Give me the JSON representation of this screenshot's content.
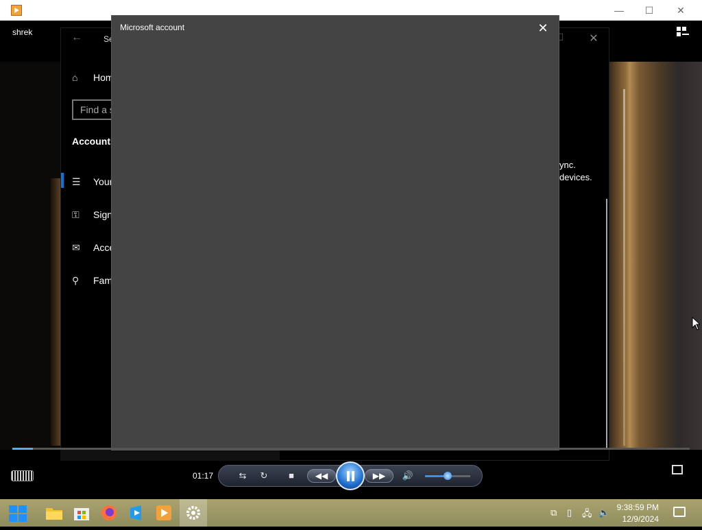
{
  "wmp": {
    "window_controls": {
      "minimize": "—",
      "maximize": "☐",
      "close": "✕"
    },
    "video_title": "shrek",
    "time": "01:17",
    "progress_fraction": 0.03,
    "volume_fraction": 0.5,
    "controls": {
      "shuffle": "⇆",
      "repeat": "↻",
      "stop": "■",
      "rewind": "◀◀",
      "fast_forward": "▶▶",
      "mute": "🔊"
    }
  },
  "settings": {
    "back": "←",
    "title": "Se",
    "max": "☐",
    "close": "✕",
    "nav": {
      "home": "Hom",
      "search_placeholder": "Find a s",
      "section": "Accounts",
      "items": [
        {
          "label": "Your",
          "icon": "☰"
        },
        {
          "label": "Sign",
          "icon": "⚿"
        },
        {
          "label": "Acce",
          "icon": "✉"
        },
        {
          "label": "Fam",
          "icon": "⚲"
        }
      ]
    },
    "partial_text_line1": "ync.",
    "partial_text_line2": "devices."
  },
  "dialog": {
    "title": "Microsoft account",
    "close": "✕"
  },
  "taskbar": {
    "clock_time": "9:38:59 PM",
    "clock_date": "12/9/2024"
  }
}
